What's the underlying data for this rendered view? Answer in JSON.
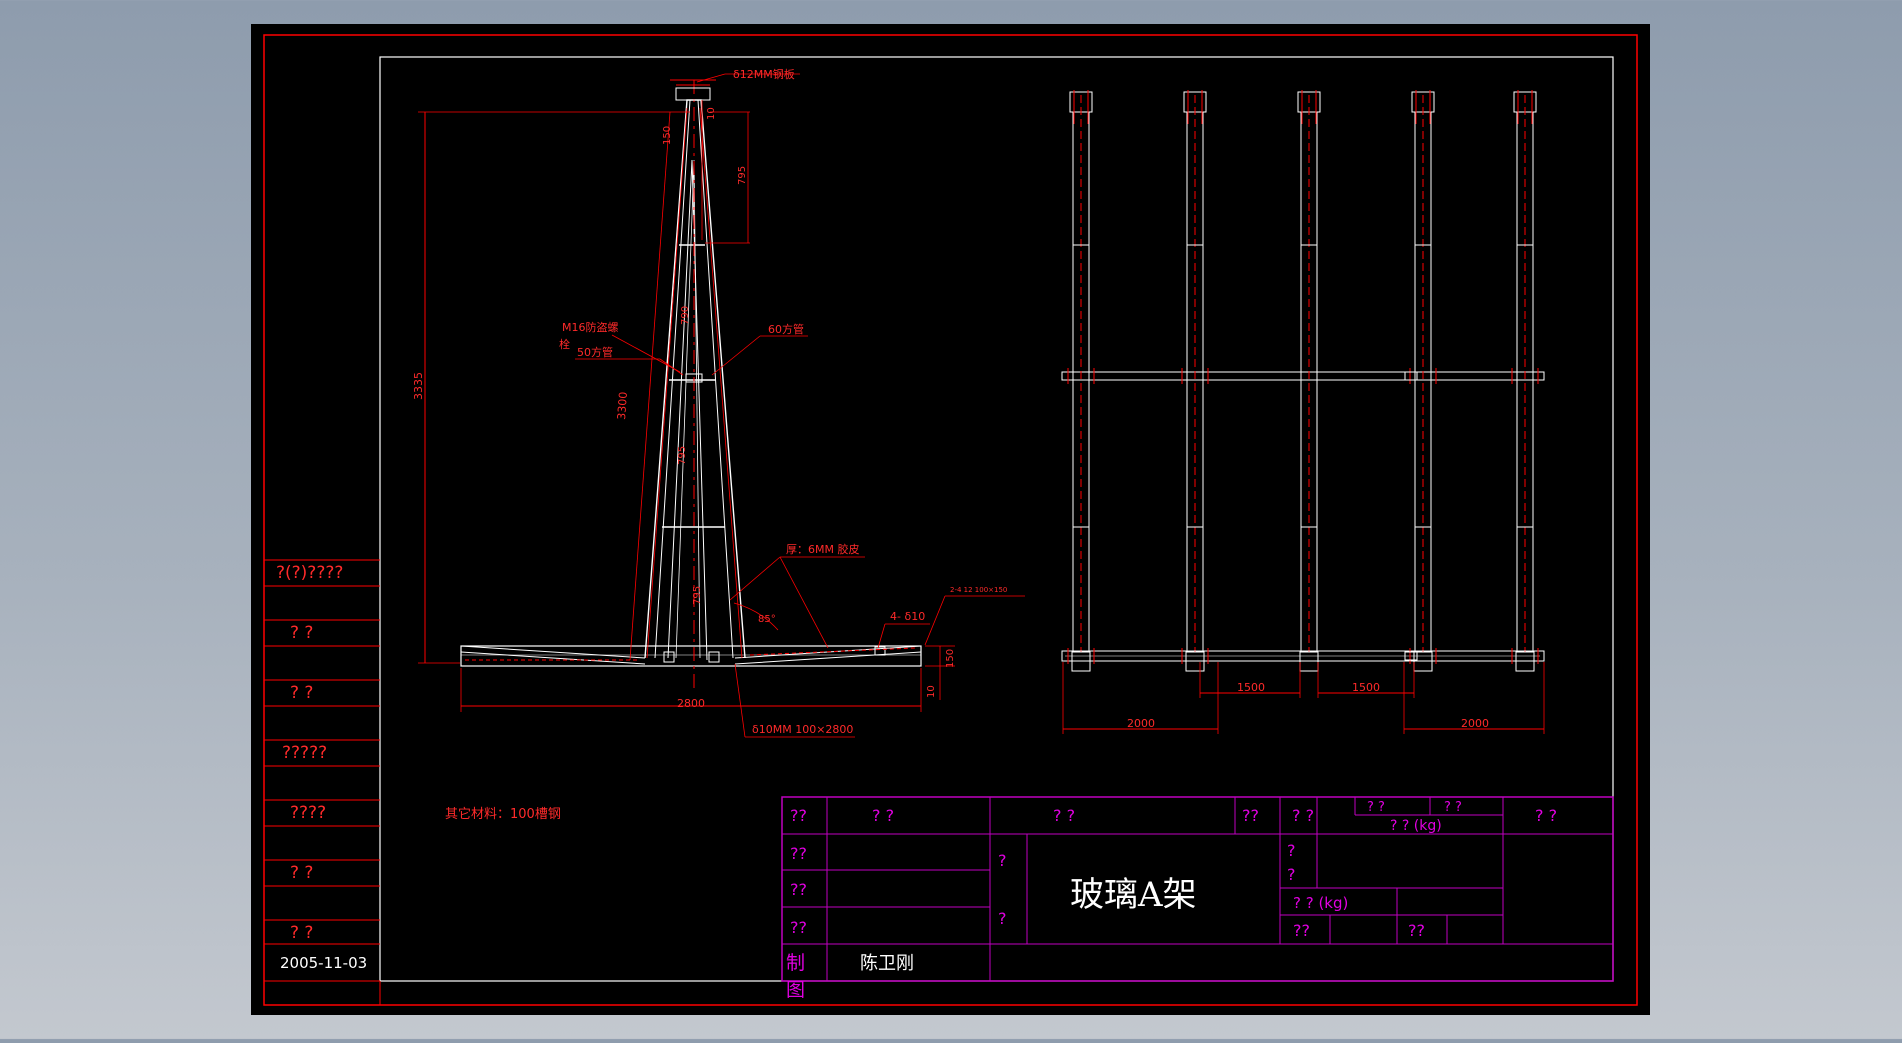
{
  "drawing": {
    "title": "玻璃A架",
    "drawer_label": "制图",
    "drawer_name": "陈卫刚",
    "date": "2005-11-03",
    "other_material_note": "其它材料：100槽钢",
    "weight_label_1": "? ? (kg)",
    "weight_label_2": "? ? (kg)"
  },
  "left_strip": {
    "labels": [
      "?(?)????",
      "?    ?",
      "?    ?",
      "?????",
      "????",
      "?    ?",
      "?    ?"
    ]
  },
  "title_block": {
    "cells": {
      "r1c1": "??",
      "r1c2": "?     ?",
      "r1c3": "?          ?",
      "r1c4": "??",
      "r1c5": "?  ?",
      "r1c6a": "?  ?",
      "r1c6b": "?  ?",
      "r1c7": "?  ?",
      "r2c1": "??",
      "r3c1": "??",
      "r4c1": "??",
      "q_left_top": "?",
      "q_left_bot": "?",
      "q_right_top": "?",
      "q_right_bot": "?",
      "r4_a": "??",
      "r4_b": "??"
    }
  },
  "annotations": {
    "top_plate": "δ12MM钢板",
    "bolt_line1": "M16防盗螺",
    "bolt_line2": "栓",
    "tube_50": "50方管",
    "tube_60": "60方管",
    "rubber": "厚：6MM 胶皮",
    "hole_note": "4- δ10",
    "plate_note": "2-4 12 100×150",
    "base_plate": "δ10MM 100×2800",
    "angle": "85°"
  },
  "dimensions": {
    "total_height": "3335",
    "inner_height": "3300",
    "top_gap": "150",
    "d795_top": "795",
    "d10_top": "10",
    "d790_mid": "790",
    "d795_low": "795",
    "d795_bottom": "795",
    "base_width": "2800",
    "base_height": "150",
    "base_10": "10",
    "span_1500_a": "1500",
    "span_1500_b": "1500",
    "span_2000_a": "2000",
    "span_2000_b": "2000"
  }
}
